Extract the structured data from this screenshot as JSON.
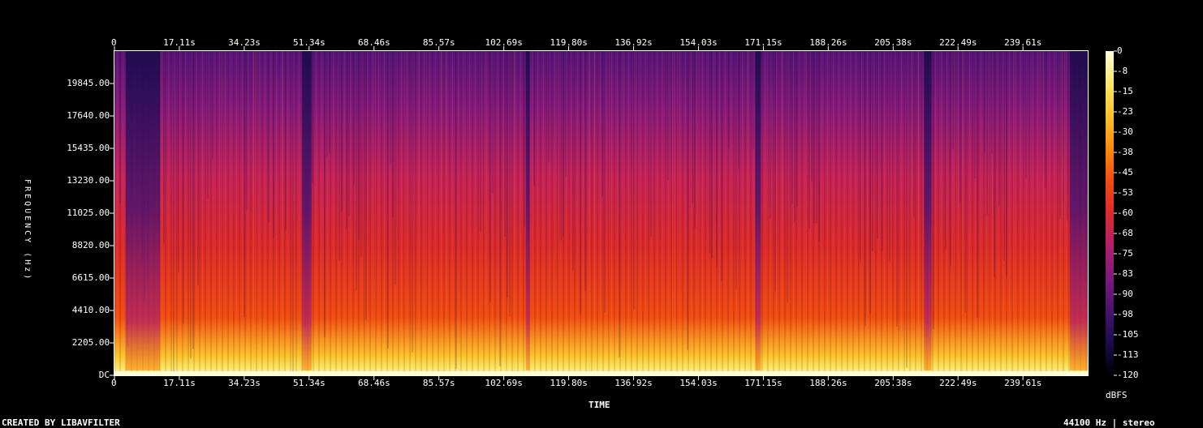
{
  "footer": {
    "credit": "CREATED BY LIBAVFILTER",
    "info": "44100 Hz | stereo"
  },
  "chart_data": {
    "type": "heatmap",
    "xlabel": "TIME",
    "ylabel": "FREQUENCY (Hz)",
    "colorbar_label": "dBFS",
    "x_ticks": [
      "0",
      "17.11s",
      "34.23s",
      "51.34s",
      "68.46s",
      "85.57s",
      "102.69s",
      "119.80s",
      "136.92s",
      "154.03s",
      "171.15s",
      "188.26s",
      "205.38s",
      "222.49s",
      "239.61s"
    ],
    "y_ticks": [
      "DC",
      "2205.00",
      "4410.00",
      "6615.00",
      "8820.00",
      "11025.00",
      "13230.00",
      "15435.00",
      "17640.00",
      "19845.00"
    ],
    "colorbar_ticks": [
      "0",
      "-8",
      "-15",
      "-23",
      "-30",
      "-38",
      "-45",
      "-53",
      "-60",
      "-68",
      "-75",
      "-83",
      "-90",
      "-98",
      "-105",
      "-113",
      "-120"
    ],
    "xlim": [
      0,
      256.7
    ],
    "ylim": [
      0,
      22050
    ],
    "zlim": [
      -120,
      0
    ],
    "colormap": [
      "#000000",
      "#1a0b4b",
      "#4b1270",
      "#7c1a7c",
      "#b01f6a",
      "#dd2a2a",
      "#f24b11",
      "#fc8b0c",
      "#fcc22a",
      "#fbe769",
      "#fefed8"
    ],
    "quiet_segments_s": [
      [
        3,
        12
      ],
      [
        49.5,
        52
      ],
      [
        108.5,
        109.5
      ],
      [
        169,
        170.5
      ],
      [
        213.5,
        215.5
      ],
      [
        252,
        256.7
      ]
    ]
  }
}
